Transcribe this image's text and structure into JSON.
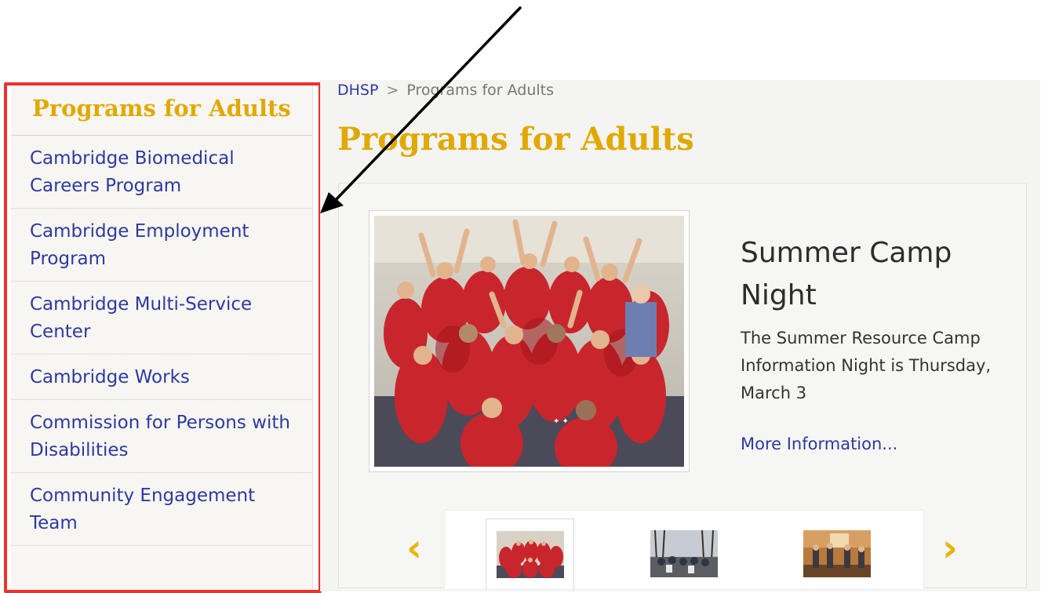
{
  "sidebar": {
    "title": "Programs for Adults",
    "items": [
      {
        "label": "Cambridge Biomedical Careers Program"
      },
      {
        "label": "Cambridge Employment Program"
      },
      {
        "label": "Cambridge Multi-Service Center"
      },
      {
        "label": "Cambridge Works"
      },
      {
        "label": "Commission for Persons with Disabilities"
      },
      {
        "label": "Community Engagement Team"
      }
    ]
  },
  "breadcrumb": {
    "root": "DHSP",
    "separator": ">",
    "current": "Programs for Adults"
  },
  "page": {
    "title": "Programs for Adults"
  },
  "feature": {
    "title": "Summer Camp Night",
    "description": "The Summer Resource Camp Information Night is Thursday, March 3",
    "link_label": "More Information..."
  },
  "carousel": {
    "prev_icon": "‹",
    "next_icon": "›"
  },
  "colors": {
    "accent": "#e1a900",
    "link": "#2e3a9e",
    "highlight": "#e7322d"
  }
}
